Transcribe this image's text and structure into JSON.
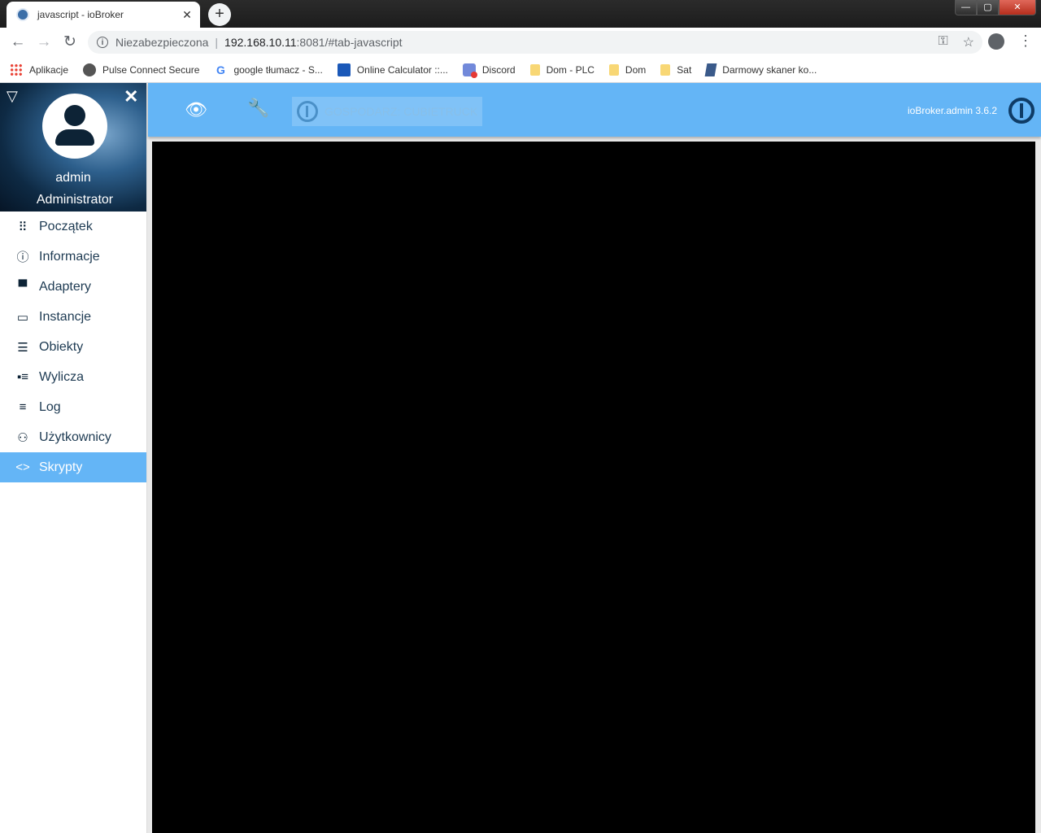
{
  "browser": {
    "tab_title": "javascript - ioBroker",
    "tab_close": "✕",
    "new_tab": "+",
    "window_buttons": {
      "minimize": "—",
      "maximize": "▢",
      "close": "✕"
    },
    "nav": {
      "back": "←",
      "forward": "→",
      "reload": "↻"
    },
    "address": {
      "security_label": "Niezabezpieczona",
      "host": "192.168.10.11",
      "path": ":8081/#tab-javascript"
    },
    "toolbar_icons": [
      "key-icon",
      "star-icon",
      "profile-icon",
      "menu-icon"
    ],
    "bookmarks": [
      {
        "label": "Aplikacje",
        "icon": "apps-icon"
      },
      {
        "label": "Pulse Connect Secure",
        "icon": "pulse-icon"
      },
      {
        "label": "google tłumacz - S...",
        "icon": "google-icon"
      },
      {
        "label": "Online Calculator ::...",
        "icon": "calculator-icon"
      },
      {
        "label": "Discord",
        "icon": "discord-icon"
      },
      {
        "label": "Dom - PLC",
        "icon": "folder-icon"
      },
      {
        "label": "Dom",
        "icon": "folder-icon"
      },
      {
        "label": "Sat",
        "icon": "folder-icon"
      },
      {
        "label": "Darmowy skaner ko...",
        "icon": "scanner-icon"
      }
    ]
  },
  "drawer": {
    "user_name": "admin",
    "user_group": "Administrator",
    "menu": [
      {
        "label": "Początek",
        "icon": "grid-icon",
        "glyph": "⠿",
        "active": false
      },
      {
        "label": "Informacje",
        "icon": "info-icon",
        "glyph": "ⓘ",
        "active": false
      },
      {
        "label": "Adaptery",
        "icon": "store-icon",
        "glyph": "▀",
        "active": false
      },
      {
        "label": "Instancje",
        "icon": "instances-icon",
        "glyph": "▭",
        "active": false
      },
      {
        "label": "Obiekty",
        "icon": "list-icon",
        "glyph": "☰",
        "active": false
      },
      {
        "label": "Wylicza",
        "icon": "enum-icon",
        "glyph": "▪≡",
        "active": false
      },
      {
        "label": "Log",
        "icon": "log-icon",
        "glyph": "≡",
        "active": false
      },
      {
        "label": "Użytkownicy",
        "icon": "user-icon",
        "glyph": "⚇",
        "active": false
      },
      {
        "label": "Skrypty",
        "icon": "code-icon",
        "glyph": "<>",
        "active": true
      }
    ]
  },
  "appbar": {
    "host_label": "GOSPODARZ: CUBIETRUCK",
    "version": "ioBroker.admin 3.6.2"
  },
  "colors": {
    "accent": "#64b5f6",
    "content_background": "#000000"
  }
}
